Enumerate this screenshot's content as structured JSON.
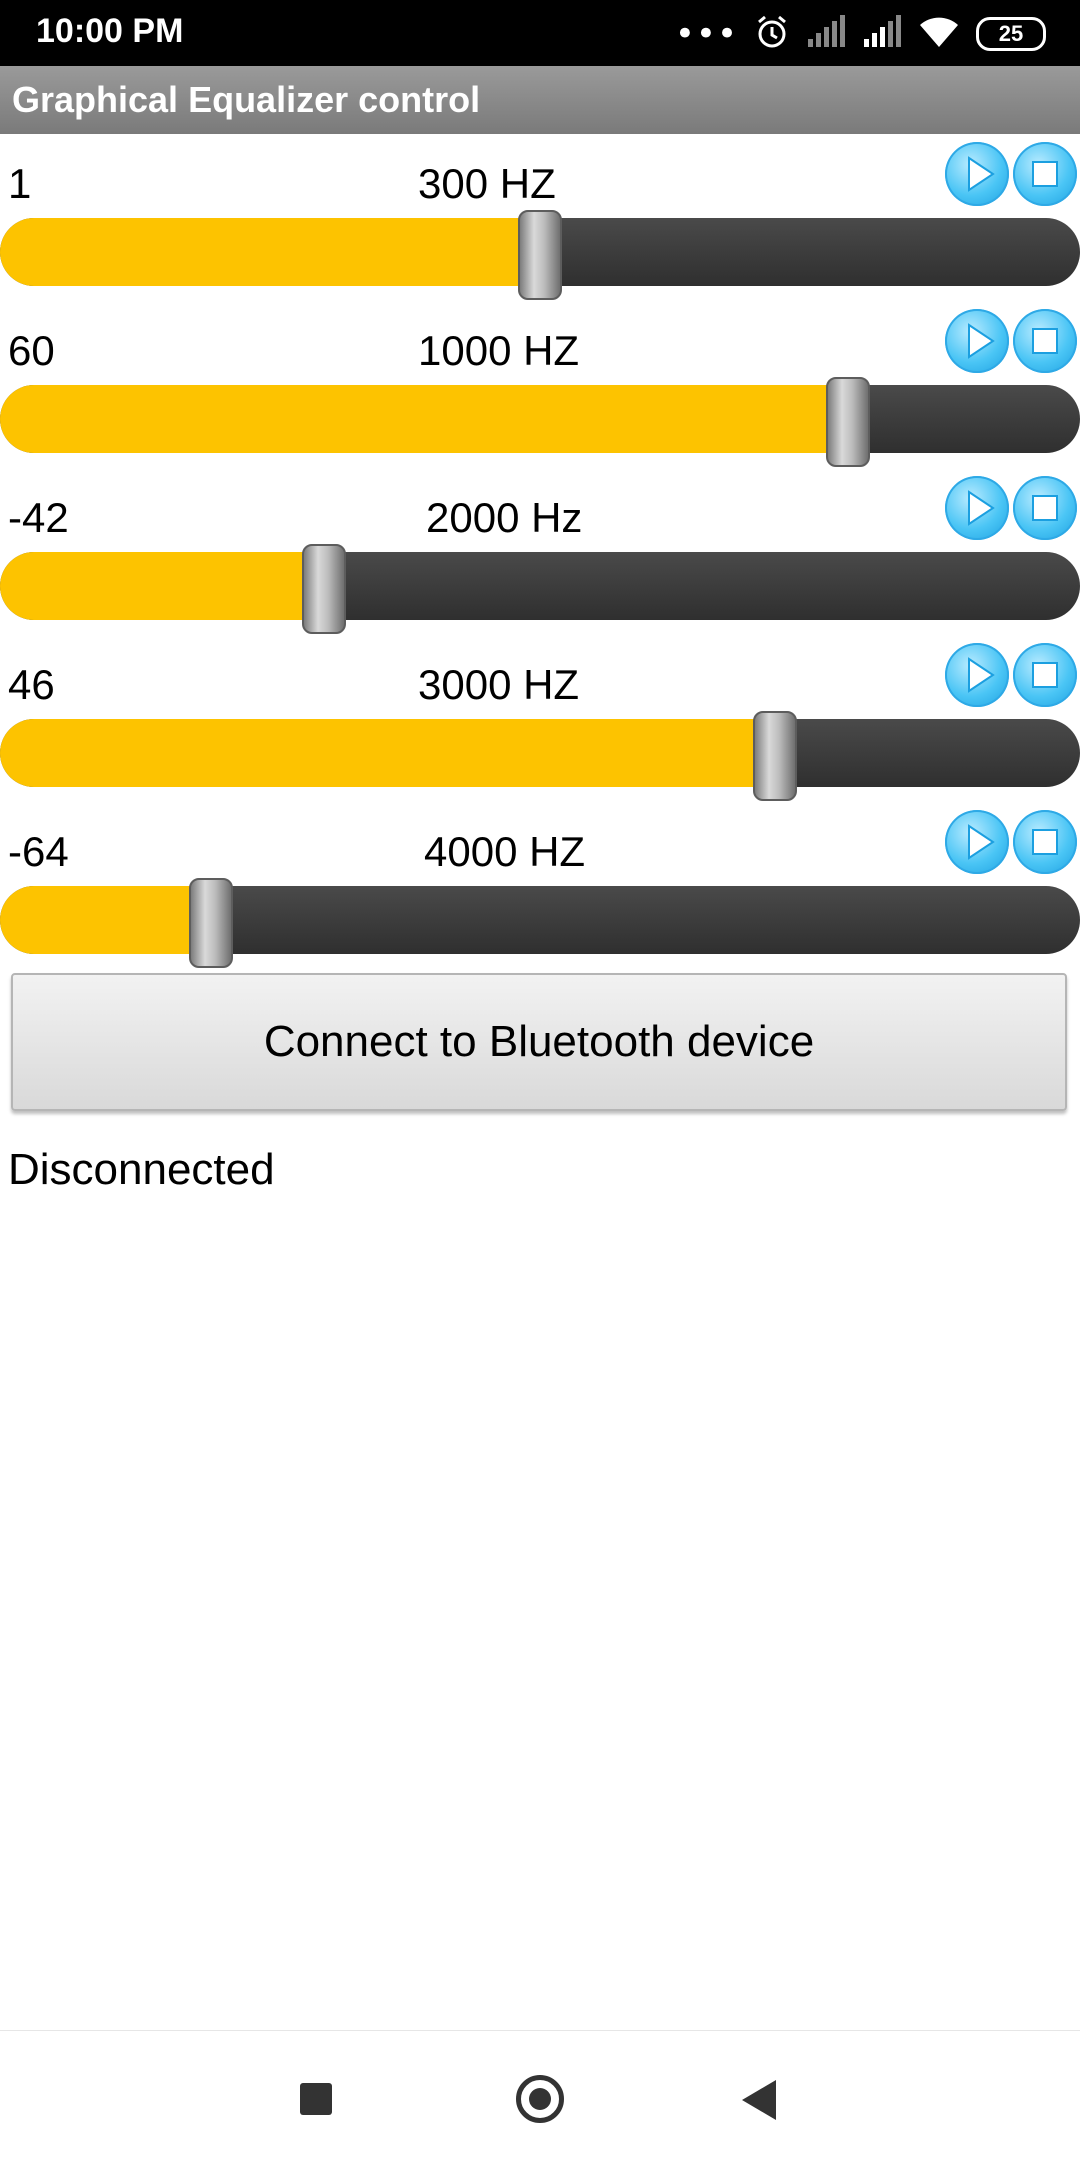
{
  "status_bar": {
    "time": "10:00 PM",
    "more_icon": "•••",
    "battery": "25",
    "icons": [
      "alarm-icon",
      "signal-icon",
      "signal-icon",
      "wifi-icon",
      "battery-icon"
    ]
  },
  "app": {
    "title": "Graphical Equalizer control"
  },
  "bands": [
    {
      "value": "1",
      "freq": "300 HZ",
      "level": 0.5
    },
    {
      "value": "60",
      "freq": "1000 HZ",
      "level": 0.785
    },
    {
      "value": "-42",
      "freq": "2000 Hz",
      "level": 0.3
    },
    {
      "value": "46",
      "freq": "3000 HZ",
      "level": 0.718
    },
    {
      "value": "-64",
      "freq": "4000 HZ",
      "level": 0.195
    }
  ],
  "colors": {
    "slider_fill": "#fdc300",
    "slider_track": "#3a3a3a",
    "title_bar": "#8a8a8a",
    "play_button": "#4ac5f5"
  },
  "connect_button": {
    "label": "Connect to Bluetooth device"
  },
  "connection_status": "Disconnected",
  "nav": [
    "recents-icon",
    "home-icon",
    "back-icon"
  ]
}
